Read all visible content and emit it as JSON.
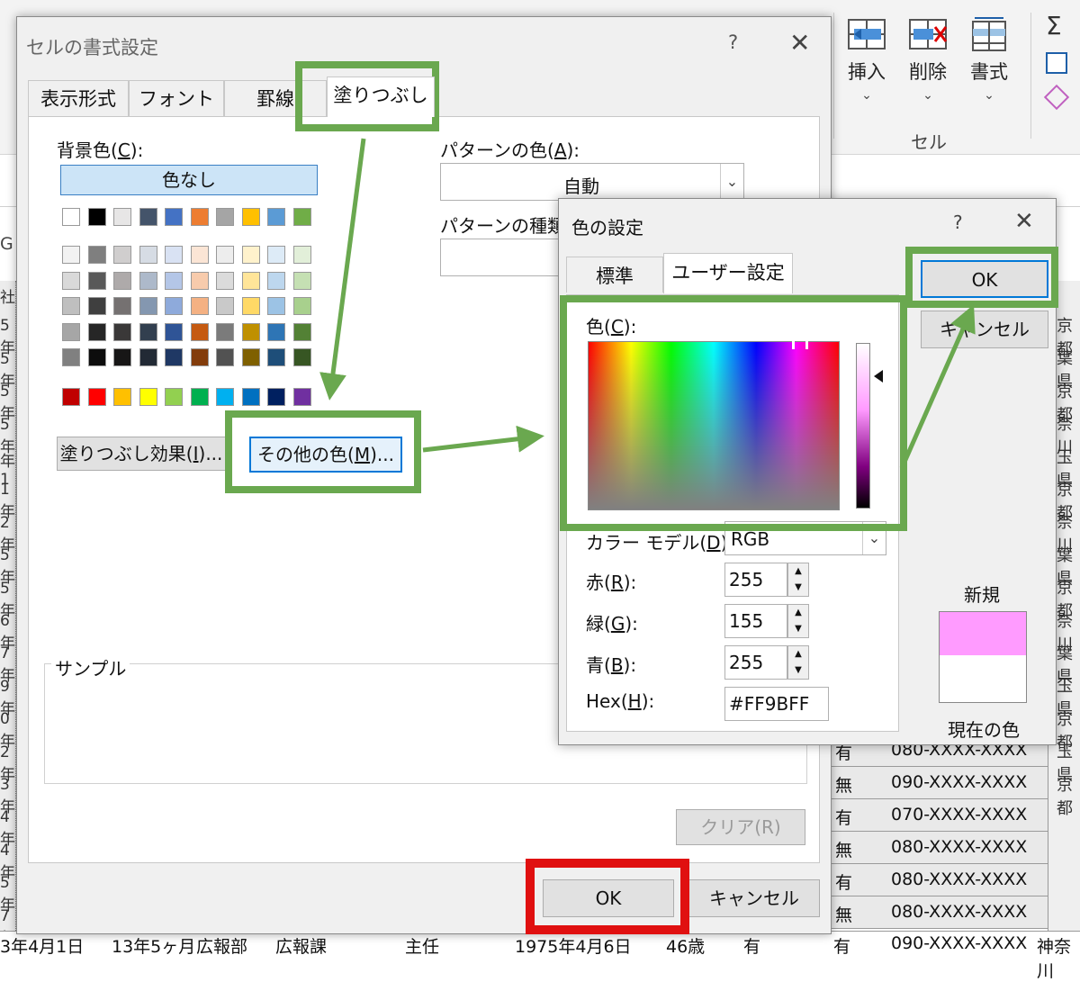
{
  "ribbon": {
    "buttons": [
      {
        "label": "挿入",
        "chevron": "⌄"
      },
      {
        "label": "削除",
        "chevron": "⌄"
      },
      {
        "label": "書式",
        "chevron": "⌄"
      }
    ],
    "group_label": "セル",
    "sigma_icon": "Σ"
  },
  "sheet": {
    "left_fragments": [
      "G",
      "社",
      "5年",
      "5年",
      "5年",
      "5年",
      "年1",
      "1年",
      "2年",
      "5年",
      "5年",
      "6年",
      "7年",
      "9年",
      "0年",
      "2年",
      "3年",
      "4年",
      "4年",
      "5年",
      "7年"
    ],
    "rows": [
      {
        "flag": "有",
        "phone": "080-XXXX-XXXX",
        "pref": "神奈川"
      },
      {
        "flag": "無",
        "phone": "090-XXXX-XXXX",
        "pref": "東京都"
      },
      {
        "flag": "有",
        "phone": "070-XXXX-XXXX",
        "pref": "東京都"
      },
      {
        "flag": "無",
        "phone": "080-XXXX-XXXX",
        "pref": "東京都"
      },
      {
        "flag": "有",
        "phone": "080-XXXX-XXXX",
        "pref": "埼玉県"
      },
      {
        "flag": "無",
        "phone": "080-XXXX-XXXX",
        "pref": "千葉県"
      }
    ],
    "right_fragments": [
      "京都",
      "葉県",
      "京都",
      "奈川",
      "玉県",
      "京都",
      "奈川",
      "葉県",
      "京都",
      "奈川",
      "葉県",
      "玉県",
      "京都",
      "玉県",
      "京都"
    ],
    "bottom_row": [
      "3年4月1日",
      "13年5ヶ月",
      "広報部",
      "広報課",
      "主任",
      "1975年4月6日",
      "46歳",
      "有",
      "有",
      "090-XXXX-XXXX",
      "神奈川"
    ]
  },
  "format_dialog": {
    "title": "セルの書式設定",
    "help": "?",
    "close": "✕",
    "tabs": [
      "表示形式",
      "フォント",
      "罫線",
      "塗りつぶし"
    ],
    "active_tab": 3,
    "background_label": {
      "pre": "背景色(",
      "key": "C",
      "post": "):"
    },
    "no_color_label": "色なし",
    "theme_colors": [
      "#ffffff",
      "#000000",
      "#e7e6e6",
      "#44546a",
      "#4472c4",
      "#ed7d31",
      "#a5a5a5",
      "#ffc000",
      "#5b9bd5",
      "#70ad47"
    ],
    "shade_rows": [
      [
        "#f2f2f2",
        "#7f7f7f",
        "#d0cece",
        "#d6dce4",
        "#d9e2f3",
        "#fbe5d5",
        "#ededed",
        "#fff2cc",
        "#ddebf7",
        "#e2efd9"
      ],
      [
        "#d9d9d9",
        "#595959",
        "#aeaaaa",
        "#adb9ca",
        "#b4c6e7",
        "#f7cbac",
        "#dbdbdb",
        "#ffe599",
        "#bdd7ee",
        "#c5e0b3"
      ],
      [
        "#bfbfbf",
        "#3f3f3f",
        "#757171",
        "#8497b0",
        "#8eaadb",
        "#f4b183",
        "#c9c9c9",
        "#ffd966",
        "#9cc3e5",
        "#a8d08d"
      ],
      [
        "#a6a6a6",
        "#262626",
        "#3a3838",
        "#323f4f",
        "#2f5496",
        "#c55a11",
        "#7b7b7b",
        "#bf9000",
        "#2e75b5",
        "#538135"
      ],
      [
        "#808080",
        "#0d0d0d",
        "#171616",
        "#222a35",
        "#1f3864",
        "#833c0b",
        "#525252",
        "#7f6000",
        "#1e4e79",
        "#375623"
      ]
    ],
    "standard_colors": [
      "#c00000",
      "#ff0000",
      "#ffc000",
      "#ffff00",
      "#92d050",
      "#00b050",
      "#00b0f0",
      "#0070c0",
      "#002060",
      "#7030a0"
    ],
    "fill_effects_btn": {
      "pre": "塗りつぶし効果(",
      "key": "I",
      "post": ")..."
    },
    "more_colors_btn": {
      "pre": "その他の色(",
      "key": "M",
      "post": ")..."
    },
    "pattern_color_label": {
      "pre": "パターンの色(",
      "key": "A",
      "post": "):"
    },
    "pattern_color_value": "自動",
    "pattern_style_label": {
      "pre": "パターンの種類(",
      "key": "P",
      "post": ""
    },
    "sample_label": "サンプル",
    "clear_btn": "クリア(R)",
    "ok": "OK",
    "cancel": "キャンセル"
  },
  "color_dialog": {
    "title": "色の設定",
    "help": "?",
    "close": "✕",
    "tabs": [
      "標準",
      "ユーザー設定"
    ],
    "active_tab": 1,
    "color_label": {
      "pre": "色(",
      "key": "C",
      "post": "):"
    },
    "model_label": {
      "pre": "カラー モデル(",
      "key": "D",
      "post": "):"
    },
    "model_value": "RGB",
    "red_label": {
      "pre": "赤(",
      "key": "R",
      "post": "):"
    },
    "green_label": {
      "pre": "緑(",
      "key": "G",
      "post": "):"
    },
    "blue_label": {
      "pre": "青(",
      "key": "B",
      "post": "):"
    },
    "hex_label": {
      "pre": "Hex(",
      "key": "H",
      "post": "):"
    },
    "red": "255",
    "green": "155",
    "blue": "255",
    "hex": "#FF9BFF",
    "new_label": "新規",
    "current_label": "現在の色",
    "new_color": "#ff9bff",
    "current_color": "#ffffff",
    "ok": "OK",
    "cancel": "キャンセル"
  }
}
